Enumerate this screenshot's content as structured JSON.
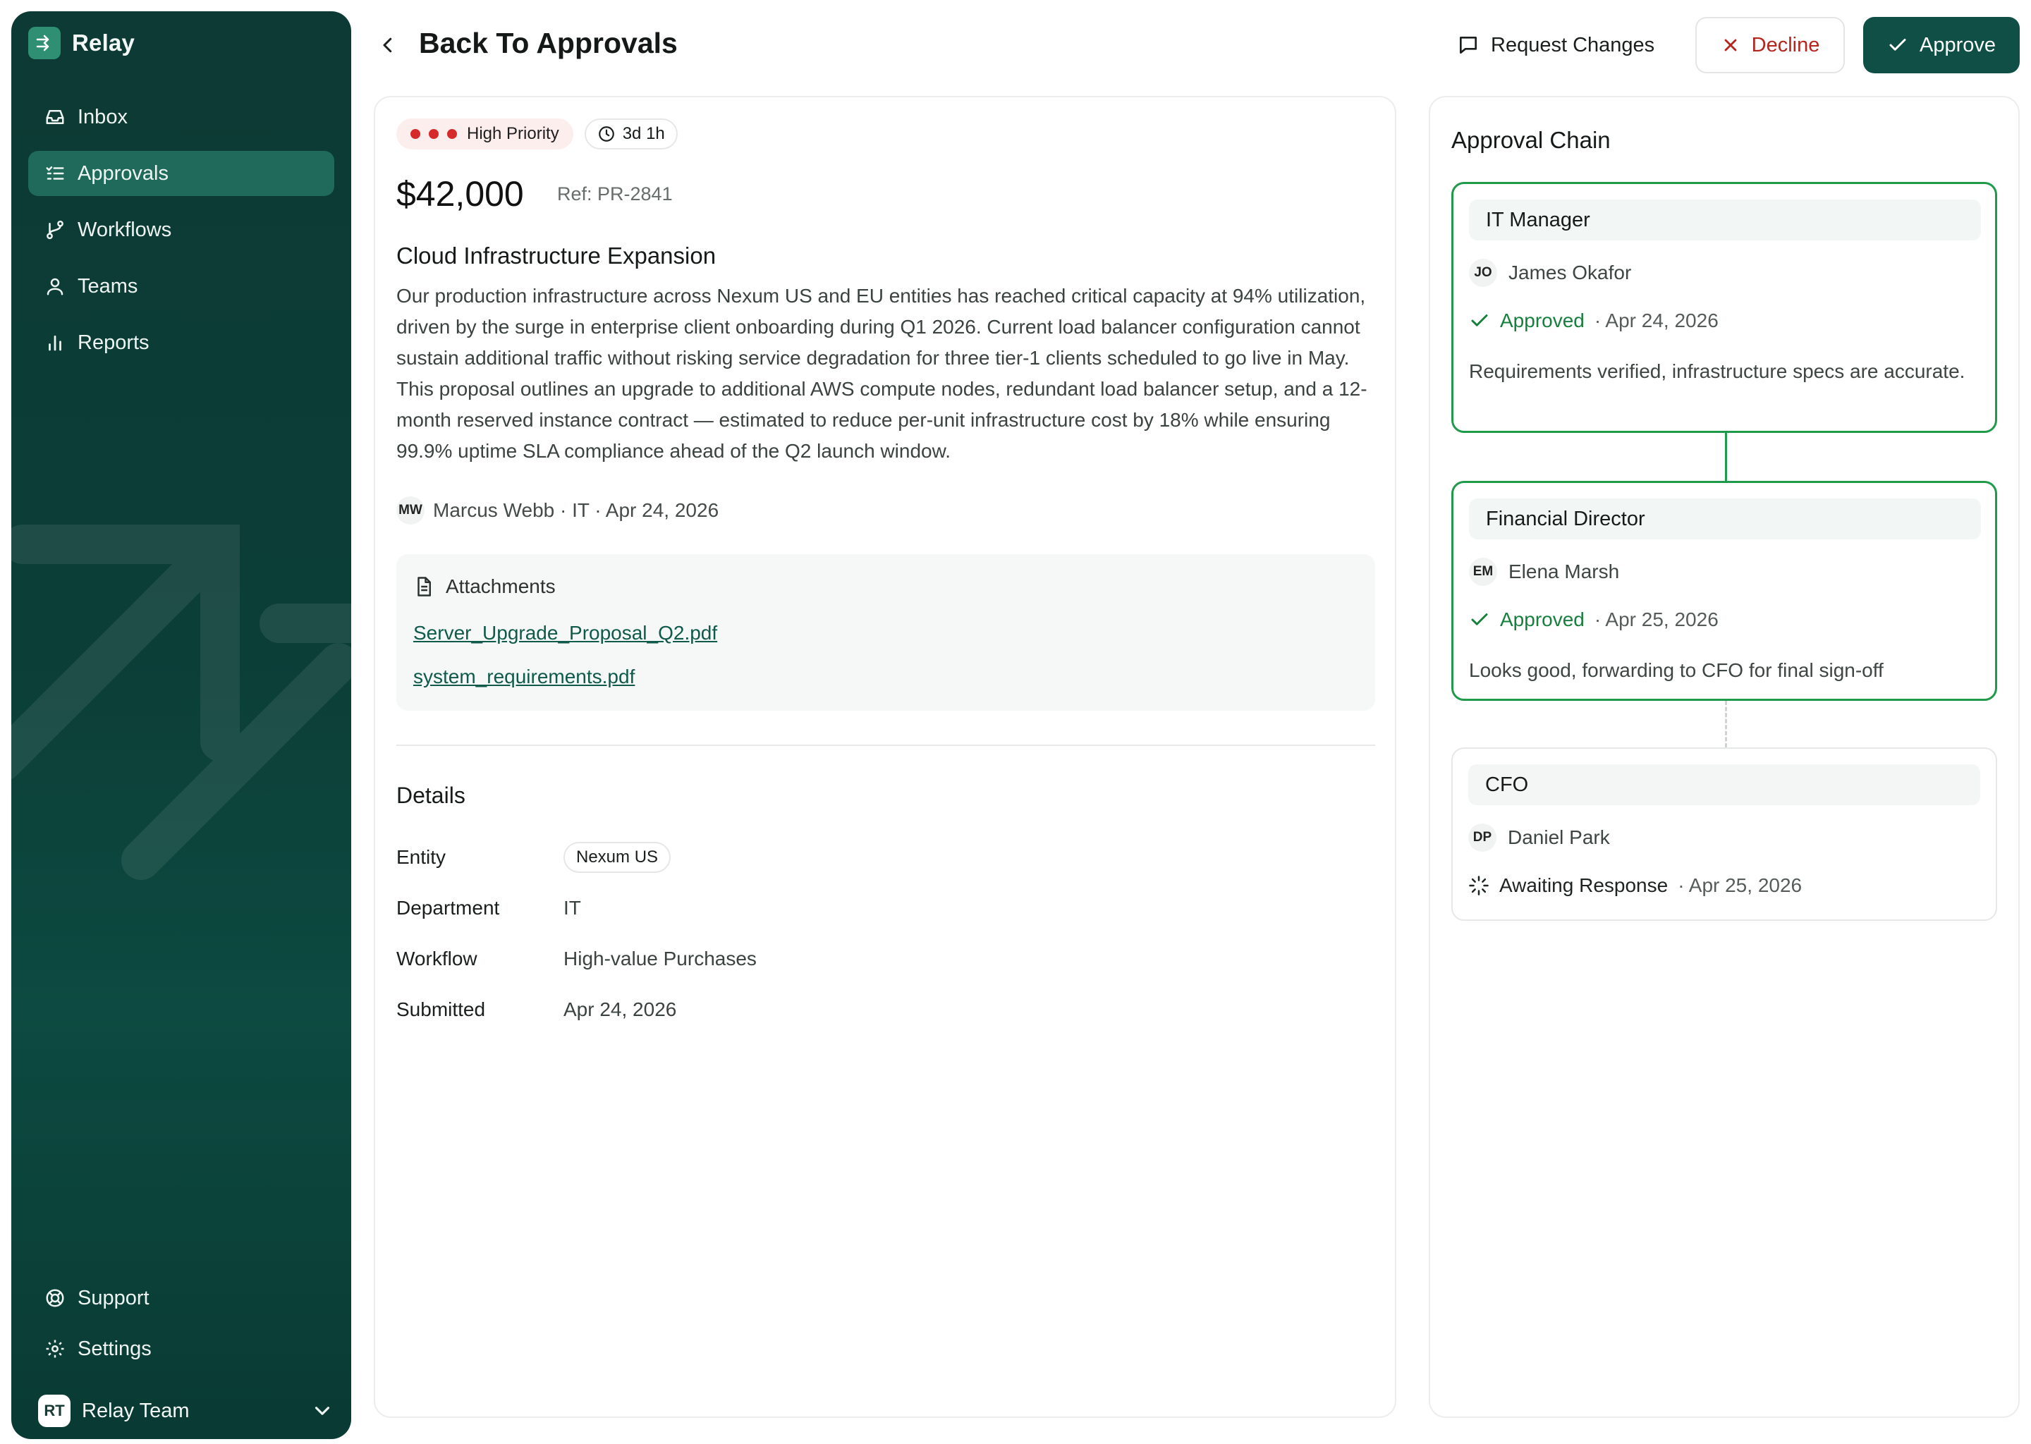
{
  "sidebar": {
    "brand": "Relay",
    "nav": [
      {
        "label": "Inbox",
        "icon": "inbox-icon"
      },
      {
        "label": "Approvals",
        "icon": "list-check-icon",
        "active": true
      },
      {
        "label": "Workflows",
        "icon": "branch-icon"
      },
      {
        "label": "Teams",
        "icon": "user-icon"
      },
      {
        "label": "Reports",
        "icon": "bar-chart-icon"
      }
    ],
    "bottom": [
      {
        "label": "Support",
        "icon": "lifebuoy-icon"
      },
      {
        "label": "Settings",
        "icon": "gear-icon"
      }
    ],
    "team": {
      "initials": "RT",
      "name": "Relay Team"
    }
  },
  "header": {
    "title": "Back To Approvals",
    "request_changes": "Request Changes",
    "decline": "Decline",
    "approve": "Approve"
  },
  "request": {
    "priority": "High Priority",
    "age": "3d 1h",
    "amount": "$42,000",
    "ref": "Ref: PR-2841",
    "title": "Cloud Infrastructure Expansion",
    "description": "Our production infrastructure across Nexum US and EU entities has reached critical capacity at 94% utilization, driven by the surge in enterprise client onboarding during Q1 2026. Current load balancer configuration cannot sustain additional traffic without risking service degradation for three tier-1 clients scheduled to go live in May. This proposal outlines an upgrade to additional AWS compute nodes, redundant load balancer setup, and a 12-month reserved instance contract — estimated to reduce per-unit infrastructure cost by 18% while ensuring 99.9% uptime SLA compliance ahead of the Q2 launch window.",
    "submitter_initials": "MW",
    "submitter_line": "Marcus Webb · IT · Apr 24, 2026"
  },
  "attachments": {
    "heading": "Attachments",
    "files": [
      "Server_Upgrade_Proposal_Q2.pdf",
      "system_requirements.pdf"
    ]
  },
  "details": {
    "heading": "Details",
    "entity_label": "Entity",
    "entity_value": "Nexum US",
    "department_label": "Department",
    "department_value": "IT",
    "workflow_label": "Workflow",
    "workflow_value": "High-value Purchases",
    "submitted_label": "Submitted",
    "submitted_value": "Apr 24, 2026"
  },
  "chain": {
    "title": "Approval Chain",
    "steps": [
      {
        "role": "IT Manager",
        "initials": "JO",
        "name": "James Okafor",
        "status": "Approved",
        "date": "· Apr 24, 2026",
        "note": "Requirements verified, infrastructure specs are accurate."
      },
      {
        "role": "Financial Director",
        "initials": "EM",
        "name": "Elena Marsh",
        "status": "Approved",
        "date": "· Apr 25, 2026",
        "note": "Looks good, forwarding to CFO for final sign-off"
      },
      {
        "role": "CFO",
        "initials": "DP",
        "name": "Daniel Park",
        "status": "Awaiting Response",
        "date": "· Apr 25, 2026"
      }
    ]
  },
  "colors": {
    "brand": "#0f4f45",
    "sidebar_bg": "#0b3e37",
    "approved": "#1f9a4a",
    "decline": "#b3261e",
    "priority_dot": "#d52b2b"
  }
}
